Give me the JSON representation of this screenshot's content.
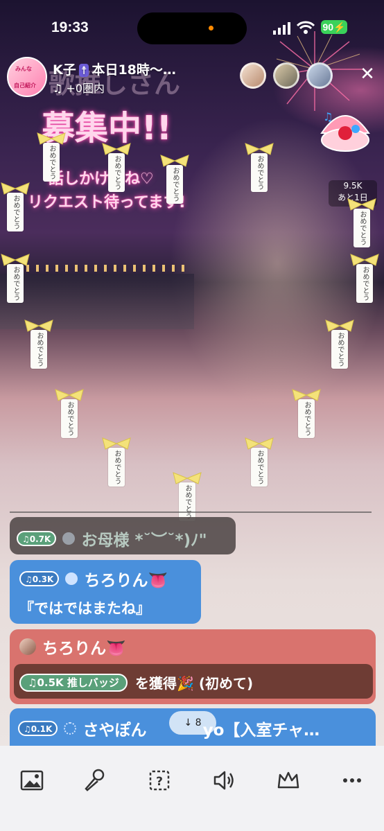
{
  "status_bar": {
    "time": "19:33",
    "battery": "90"
  },
  "header": {
    "host_name": "K子",
    "host_emoji": "☨",
    "title_rest": "本日18時〜…",
    "sub": "+0圏内",
    "avatar_text_1": "みんな",
    "avatar_text_2": "自己紹介"
  },
  "banner": {
    "line1": "歌推しさん",
    "line2": "募集中!!",
    "line3": "話しかけてね♡",
    "line4": "リクエスト待ってます!"
  },
  "side_gift": {
    "count": "9.5K",
    "remaining": "あと1日"
  },
  "charm_text": "おめでとう",
  "messages": [
    {
      "pill": "♫0.7K",
      "name": "お母様 *˘︶˘*)ﾉ\""
    },
    {
      "pill": "♫0.3K",
      "name": "ちろりん👅",
      "body": "『ではではまたね』"
    },
    {
      "name": "ちろりん👅",
      "badge_pill": "♫0.5K 推しバッジ",
      "badge_text": "を獲得🎉 (初めて)"
    },
    {
      "pill": "♫0.1K",
      "name": "さやぽん",
      "tail": "yo【入室チャ…"
    }
  ],
  "scroll_chip": "↓ 8",
  "toolbar": [
    "image-icon",
    "microphone-icon",
    "question-icon",
    "speaker-icon",
    "crown-icon",
    "more-icon"
  ],
  "colors": {
    "chat_blue": "#4a90dc",
    "chat_red": "#d9736e",
    "chat_gray": "#504848",
    "badge_green": "#5aa07a"
  }
}
